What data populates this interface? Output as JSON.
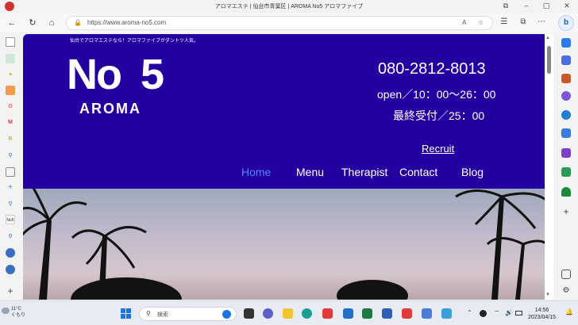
{
  "window": {
    "title": "アロマエステ | 仙台市青葉区 | AROMA No5 アロマファイブ",
    "minimize": "–",
    "maximize": "▢",
    "close": "✕"
  },
  "toolbar": {
    "back": "←",
    "refresh": "↻",
    "home": "⌂",
    "url": "https://www.aroma-no5.com",
    "read_aloud": "A",
    "copilot": "b"
  },
  "site": {
    "tagline": "仙台でアロマエステなら！アロマファイブがダントツ人気。",
    "logo_no": "No",
    "logo_five": "5",
    "logo_aroma": "AROMA",
    "phone": "080-2812-8013",
    "hours": "open／10：00〜26：00",
    "last_call": "最終受付／25：00",
    "recruit": "Recruit",
    "nav": [
      {
        "label": "Home"
      },
      {
        "label": "Menu"
      },
      {
        "label": "Therapist"
      },
      {
        "label": "Contact"
      },
      {
        "label": "Blog"
      }
    ]
  },
  "taskbar": {
    "temperature": "11°C",
    "weather": "くもり",
    "search_placeholder": "検索",
    "time": "14:56",
    "date": "2023/04/15"
  },
  "colors": {
    "header_bg": "#2400a0",
    "nav_active": "#4b8cf7"
  }
}
